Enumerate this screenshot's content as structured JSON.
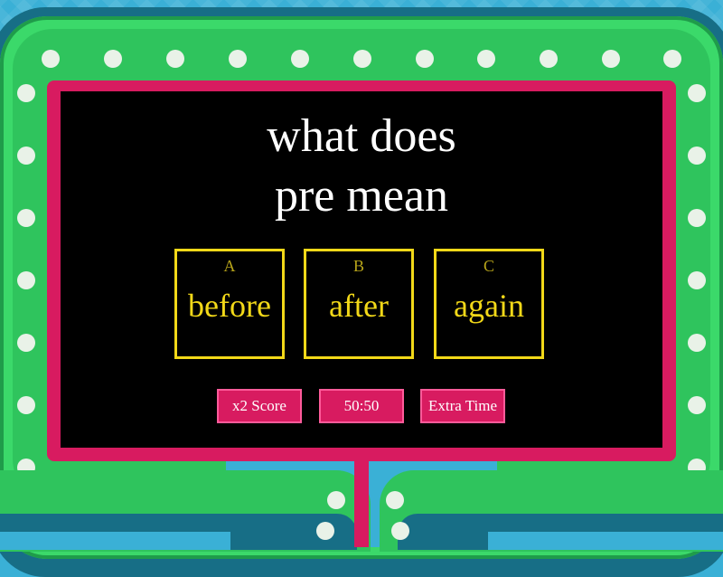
{
  "question": {
    "line1": "what does",
    "line2": "pre mean"
  },
  "answers": [
    {
      "letter": "A",
      "text": "before"
    },
    {
      "letter": "B",
      "text": "after"
    },
    {
      "letter": "C",
      "text": "again"
    }
  ],
  "powerups": {
    "double_score": "x2 Score",
    "fifty_fifty": "50:50",
    "extra_time": "Extra Time"
  },
  "colors": {
    "background": "#3ab0d6",
    "frame_green": "#3bd96a",
    "frame_pink": "#d81b60",
    "answer_yellow": "#f2d818",
    "screen": "#000000"
  }
}
